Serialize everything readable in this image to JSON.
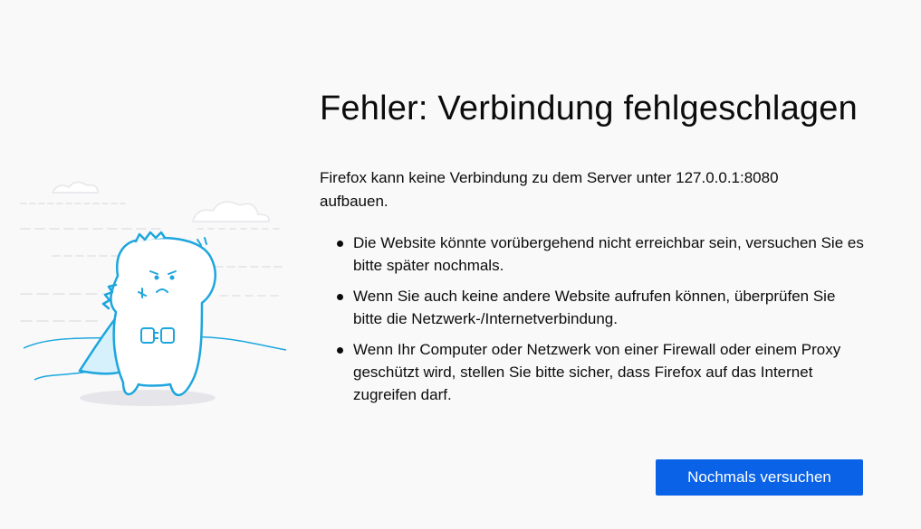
{
  "error": {
    "title": "Fehler: Verbindung fehlgeschlagen",
    "short_description": "Firefox kann keine Verbindung zu dem Server unter 127.0.0.1:8080 aufbauen.",
    "tips": [
      "Die Website könnte vorübergehend nicht erreichbar sein, versuchen Sie es bitte später nochmals.",
      "Wenn Sie auch keine andere Website aufrufen können, überprüfen Sie bitte die Netzwerk-/Internetverbindung.",
      "Wenn Ihr Computer oder Netzwerk von einer Firewall oder einem Proxy geschützt wird, stellen Sie bitte sicher, dass Firefox auf das Internet zugreifen darf."
    ],
    "try_again_label": "Nochmals versuchen"
  },
  "illustration": {
    "icon": "unplugged-dinosaur-illustration"
  },
  "colors": {
    "background": "#f9f9fa",
    "accent": "#0a63e6",
    "illustration_stroke": "#1da6dd",
    "illustration_fill": "#d6f1fb",
    "text": "#0c0c0d"
  }
}
